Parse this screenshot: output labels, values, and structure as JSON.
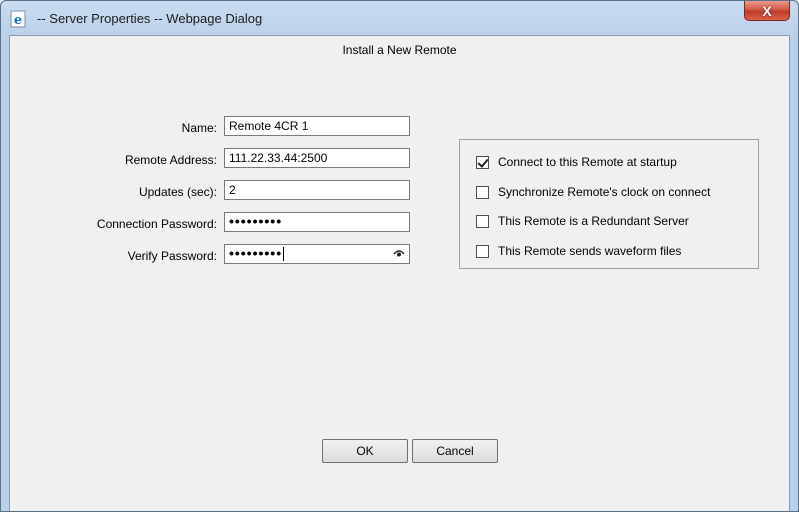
{
  "window": {
    "title": "-- Server Properties -- Webpage Dialog",
    "close_label": "X"
  },
  "heading": "Install a New Remote",
  "fields": {
    "name": {
      "label": "Name:",
      "value": "Remote 4CR 1"
    },
    "address": {
      "label": "Remote Address:",
      "value": "111.22.33.44:2500"
    },
    "updates": {
      "label": "Updates (sec):",
      "value": "2"
    },
    "conn_password": {
      "label": "Connection Password:",
      "value": "•••••••••"
    },
    "verify_password": {
      "label": "Verify Password:",
      "value": "•••••••••"
    }
  },
  "options": [
    {
      "label": "Connect to this Remote at startup",
      "checked": true
    },
    {
      "label": "Synchronize Remote's clock on connect",
      "checked": false
    },
    {
      "label": "This Remote is a Redundant Server",
      "checked": false
    },
    {
      "label": "This Remote sends waveform files",
      "checked": false
    }
  ],
  "buttons": {
    "ok": "OK",
    "cancel": "Cancel"
  },
  "icons": {
    "title": "ie-page-icon",
    "reveal": "eye-reveal-icon"
  }
}
